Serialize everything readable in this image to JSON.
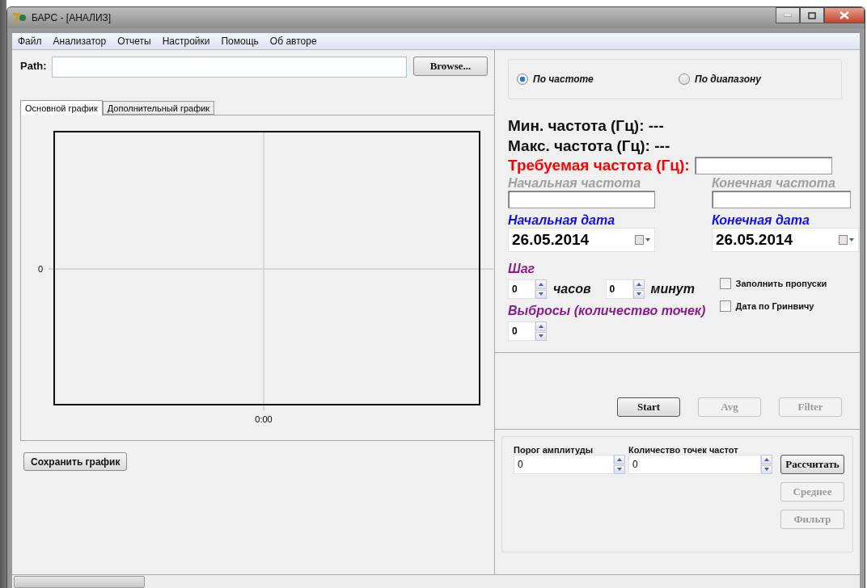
{
  "window": {
    "title": "БАРС - [АНАЛИЗ]"
  },
  "menu": [
    {
      "label": "Файл"
    },
    {
      "label": "Анализатор"
    },
    {
      "label": "Отчеты"
    },
    {
      "label": "Настройки"
    },
    {
      "label": "Помощь"
    },
    {
      "label": "Об авторе"
    }
  ],
  "path": {
    "label": "Path:",
    "button": "Browse..."
  },
  "tabs": [
    {
      "label": "Основной график",
      "selected": true
    },
    {
      "label": "Дополнительный график",
      "selected": false
    }
  ],
  "chart": {
    "y_tick": "0",
    "x_tick": "0:00"
  },
  "save_button": "Сохранить график",
  "mode_radios": [
    {
      "label": "По частоте",
      "selected": true
    },
    {
      "label": "По диапазону",
      "selected": false
    }
  ],
  "min_freq": "Мин. частота (Гц): ---",
  "max_freq": "Макс. частота (Гц): ---",
  "required_freq": {
    "label": "Требуемая частота (Гц):"
  },
  "range_fields": [
    {
      "label": "Начальная частота",
      "disabled": true
    },
    {
      "label": "Конечная частота",
      "disabled": true
    }
  ],
  "date_fields": [
    {
      "label": "Начальная дата",
      "value": "26.05.2014"
    },
    {
      "label": "Конечная дата",
      "value": "26.05.2014"
    }
  ],
  "step": {
    "label": "Шаг",
    "hours": "0",
    "hours_unit": "часов",
    "minutes": "0",
    "minutes_unit": "минут"
  },
  "checkboxes": [
    {
      "label": "Заполнить пропуски",
      "checked": false
    },
    {
      "label": "Дата по Гринвичу",
      "checked": false
    }
  ],
  "outliers": {
    "label": "Выбросы (количество точек)",
    "value": "0"
  },
  "action_buttons": [
    {
      "label": "Start",
      "disabled": false
    },
    {
      "label": "Avg",
      "disabled": true
    },
    {
      "label": "Filter",
      "disabled": true
    }
  ],
  "threshold": {
    "label": "Порог амплитуды",
    "value": "0"
  },
  "points": {
    "label": "Количество точек частот",
    "value": "0"
  },
  "calc_buttons": [
    {
      "label": "Рассчитать",
      "disabled": false
    },
    {
      "label": "Среднее",
      "disabled": true
    },
    {
      "label": "Фильтр",
      "disabled": true
    }
  ]
}
